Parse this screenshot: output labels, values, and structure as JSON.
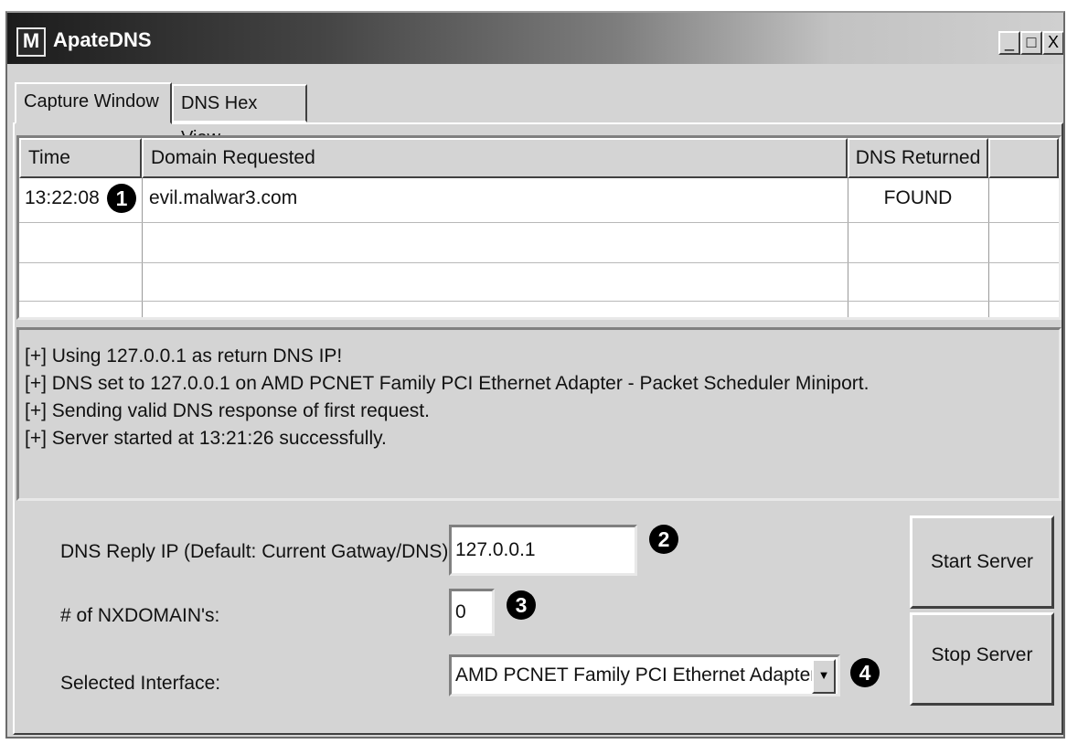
{
  "window": {
    "title": "ApateDNS",
    "icon_letter": "M",
    "controls": {
      "minimize": "_",
      "maximize": "□",
      "close": "X"
    }
  },
  "tabs": [
    {
      "label": "Capture Window",
      "active": true
    },
    {
      "label": "DNS Hex View",
      "active": false
    }
  ],
  "capture_table": {
    "columns": [
      "Time",
      "Domain Requested",
      "DNS Returned"
    ],
    "rows": [
      {
        "time": "13:22:08",
        "domain": "evil.malwar3.com",
        "dns_returned": "FOUND"
      }
    ]
  },
  "log": [
    "[+] Using 127.0.0.1 as return DNS IP!",
    "[+] DNS set to 127.0.0.1 on AMD PCNET Family PCI Ethernet Adapter - Packet Scheduler Miniport.",
    "[+] Sending valid DNS response of first request.",
    "[+] Server started at 13:21:26 successfully."
  ],
  "form": {
    "dns_reply_label": "DNS Reply IP (Default: Current Gatway/DNS):",
    "dns_reply_value": "127.0.0.1",
    "nxdomain_label": "# of NXDOMAIN's:",
    "nxdomain_value": "0",
    "interface_label": "Selected Interface:",
    "interface_value": "AMD PCNET Family PCI Ethernet Adapter - P"
  },
  "buttons": {
    "start": "Start Server",
    "stop": "Stop Server"
  },
  "callouts": [
    "1",
    "2",
    "3",
    "4"
  ],
  "colors": {
    "window_bg": "#d4d4d4",
    "titlebar_dark": "#1c1c1c",
    "callout": "#000000"
  }
}
